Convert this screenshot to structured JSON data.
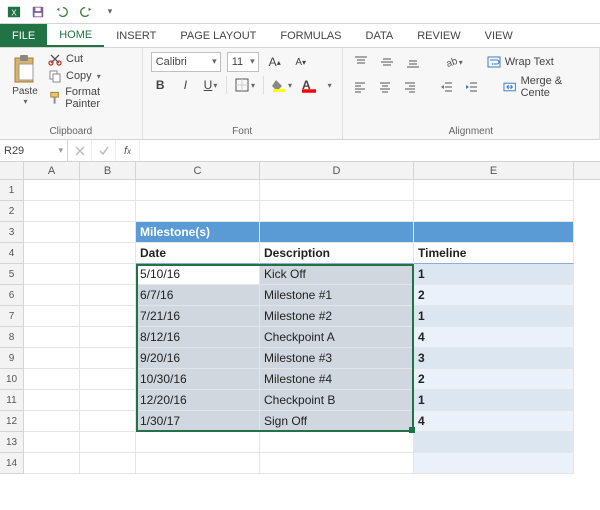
{
  "qat": {
    "save": "save-icon",
    "undo": "undo-icon",
    "redo": "redo-icon"
  },
  "tabs": {
    "file": "FILE",
    "items": [
      "HOME",
      "INSERT",
      "PAGE LAYOUT",
      "FORMULAS",
      "DATA",
      "REVIEW",
      "VIEW"
    ],
    "active": "HOME"
  },
  "ribbon": {
    "clipboard": {
      "paste": "Paste",
      "cut": "Cut",
      "copy": "Copy",
      "format_painter": "Format Painter",
      "label": "Clipboard"
    },
    "font": {
      "name": "Calibri",
      "size": "11",
      "label": "Font"
    },
    "alignment": {
      "wrap": "Wrap Text",
      "merge": "Merge & Cente",
      "label": "Alignment"
    }
  },
  "namebox": "R29",
  "formula": "",
  "columns": [
    "A",
    "B",
    "C",
    "D",
    "E"
  ],
  "row_count": 14,
  "table": {
    "title": "Milestone(s)",
    "headers": {
      "date": "Date",
      "desc": "Description",
      "timeline": "Timeline"
    },
    "rows": [
      {
        "date": "5/10/16",
        "desc": "Kick Off",
        "timeline": "1"
      },
      {
        "date": "6/7/16",
        "desc": "Milestone #1",
        "timeline": "2"
      },
      {
        "date": "7/21/16",
        "desc": "Milestone #2",
        "timeline": "1"
      },
      {
        "date": "8/12/16",
        "desc": "Checkpoint A",
        "timeline": "4"
      },
      {
        "date": "9/20/16",
        "desc": "Milestone #3",
        "timeline": "3"
      },
      {
        "date": "10/30/16",
        "desc": "Milestone #4",
        "timeline": "2"
      },
      {
        "date": "12/20/16",
        "desc": "Checkpoint B",
        "timeline": "1"
      },
      {
        "date": "1/30/17",
        "desc": "Sign Off",
        "timeline": "4"
      }
    ]
  },
  "chart_data": {
    "type": "table",
    "title": "Milestone(s)",
    "columns": [
      "Date",
      "Description",
      "Timeline"
    ],
    "rows": [
      [
        "5/10/16",
        "Kick Off",
        1
      ],
      [
        "6/7/16",
        "Milestone #1",
        2
      ],
      [
        "7/21/16",
        "Milestone #2",
        1
      ],
      [
        "8/12/16",
        "Checkpoint A",
        4
      ],
      [
        "9/20/16",
        "Milestone #3",
        3
      ],
      [
        "10/30/16",
        "Milestone #4",
        2
      ],
      [
        "12/20/16",
        "Checkpoint B",
        1
      ],
      [
        "1/30/17",
        "Sign Off",
        4
      ]
    ]
  }
}
